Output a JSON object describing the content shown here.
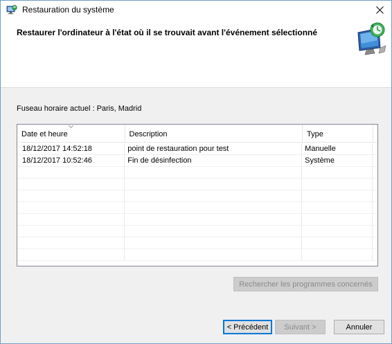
{
  "window": {
    "title": "Restauration du système"
  },
  "header": {
    "title": "Restaurer l'ordinateur à l'état où il se trouvait avant l'événement sélectionné",
    "icon": "system-restore-monitor-icon"
  },
  "timezone_label": "Fuseau horaire actuel : Paris, Madrid",
  "table": {
    "columns": [
      "Date et heure",
      "Description",
      "Type",
      ""
    ],
    "sort_column": "Date et heure",
    "rows": [
      {
        "date": "18/12/2017 14:52:18",
        "description": "point de restauration pour test",
        "type": "Manuelle"
      },
      {
        "date": "18/12/2017 10:52:46",
        "description": "Fin de désinfection",
        "type": "Système"
      }
    ]
  },
  "buttons": {
    "scan": "Rechercher les programmes concernés",
    "previous": "< Précédent",
    "next": "Suivant >",
    "cancel": "Annuler"
  },
  "colors": {
    "window_border": "#6e9ec8",
    "default_button_border": "#0078d7",
    "dialog_bg": "#f0f0f0"
  }
}
